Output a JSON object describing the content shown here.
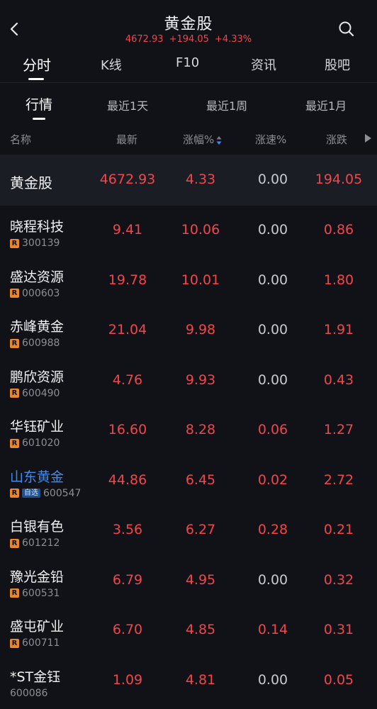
{
  "header": {
    "title": "黄金股",
    "price": "4672.93",
    "change": "+194.05",
    "change_pct": "+4.33%"
  },
  "main_tabs": [
    "分时",
    "K线",
    "F10",
    "资讯",
    "股吧"
  ],
  "sub_tabs": [
    "行情",
    "最近1天",
    "最近1周",
    "最近1月"
  ],
  "columns": {
    "name": "名称",
    "latest": "最新",
    "change_pct": "涨幅%",
    "speed": "涨速%",
    "change": "涨跌"
  },
  "index_row": {
    "name": "黄金股",
    "latest": "4672.93",
    "change_pct": "4.33",
    "speed": "0.00",
    "change": "194.05"
  },
  "rows": [
    {
      "name": "晓程科技",
      "code": "300139",
      "latest": "9.41",
      "change_pct": "10.06",
      "speed": "0.00",
      "change": "0.86"
    },
    {
      "name": "盛达资源",
      "code": "000603",
      "latest": "19.78",
      "change_pct": "10.01",
      "speed": "0.00",
      "change": "1.80"
    },
    {
      "name": "赤峰黄金",
      "code": "600988",
      "latest": "21.04",
      "change_pct": "9.98",
      "speed": "0.00",
      "change": "1.91"
    },
    {
      "name": "鹏欣资源",
      "code": "600490",
      "latest": "4.76",
      "change_pct": "9.93",
      "speed": "0.00",
      "change": "0.43"
    },
    {
      "name": "华钰矿业",
      "code": "601020",
      "latest": "16.60",
      "change_pct": "8.28",
      "speed": "0.06",
      "change": "1.27"
    },
    {
      "name": "山东黄金",
      "code": "600547",
      "badge": "自选",
      "latest": "44.86",
      "change_pct": "6.45",
      "speed": "0.02",
      "change": "2.72"
    },
    {
      "name": "白银有色",
      "code": "601212",
      "latest": "3.56",
      "change_pct": "6.27",
      "speed": "0.28",
      "change": "0.21"
    },
    {
      "name": "豫光金铅",
      "code": "600531",
      "latest": "6.79",
      "change_pct": "4.95",
      "speed": "0.00",
      "change": "0.32"
    },
    {
      "name": "盛屯矿业",
      "code": "600711",
      "latest": "6.70",
      "change_pct": "4.85",
      "speed": "0.14",
      "change": "0.31"
    },
    {
      "name": "*ST金钰",
      "code": "600086",
      "latest": "1.09",
      "change_pct": "4.81",
      "speed": "0.00",
      "change": "0.05"
    }
  ],
  "r_label": "R",
  "colors": {
    "up": "#f0464c",
    "bg": "#111217",
    "highlight": "#3d8cf0",
    "r_badge": "#e8862b"
  }
}
